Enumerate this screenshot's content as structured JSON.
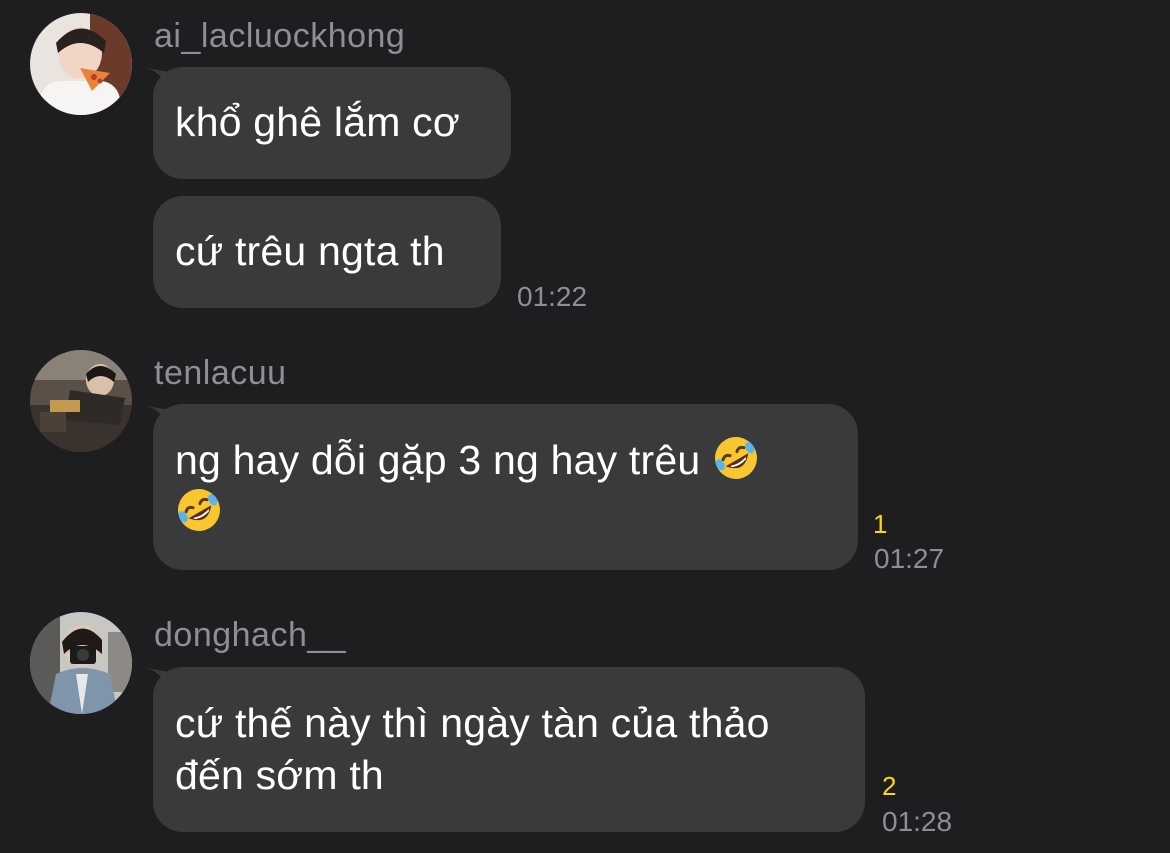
{
  "messages": [
    {
      "sender": "ai_lacluockhong",
      "avatar": "user-avatar-photo",
      "bubbles": [
        "khổ ghê lắm cơ",
        "cứ trêu ngta th"
      ],
      "time": "01:22"
    },
    {
      "sender": "tenlacuu",
      "avatar": "user-avatar-photo",
      "bubbles": [
        "ng hay dỗi gặp 3 ng hay trêu"
      ],
      "emoji": "rolling-on-floor-laughing-emoji",
      "unread_count": "1",
      "time": "01:27"
    },
    {
      "sender": "donghach__",
      "avatar": "user-avatar-photo",
      "bubbles": [
        "cứ thế này thì ngày tàn của thảo",
        "đến sớm th"
      ],
      "unread_count": "2",
      "time": "01:28"
    }
  ],
  "colors": {
    "background": "#1e1e20",
    "bubble": "#3a3a3c",
    "sender": "#8e8e93",
    "time": "#8e8e93",
    "unread": "#ffd60a"
  }
}
